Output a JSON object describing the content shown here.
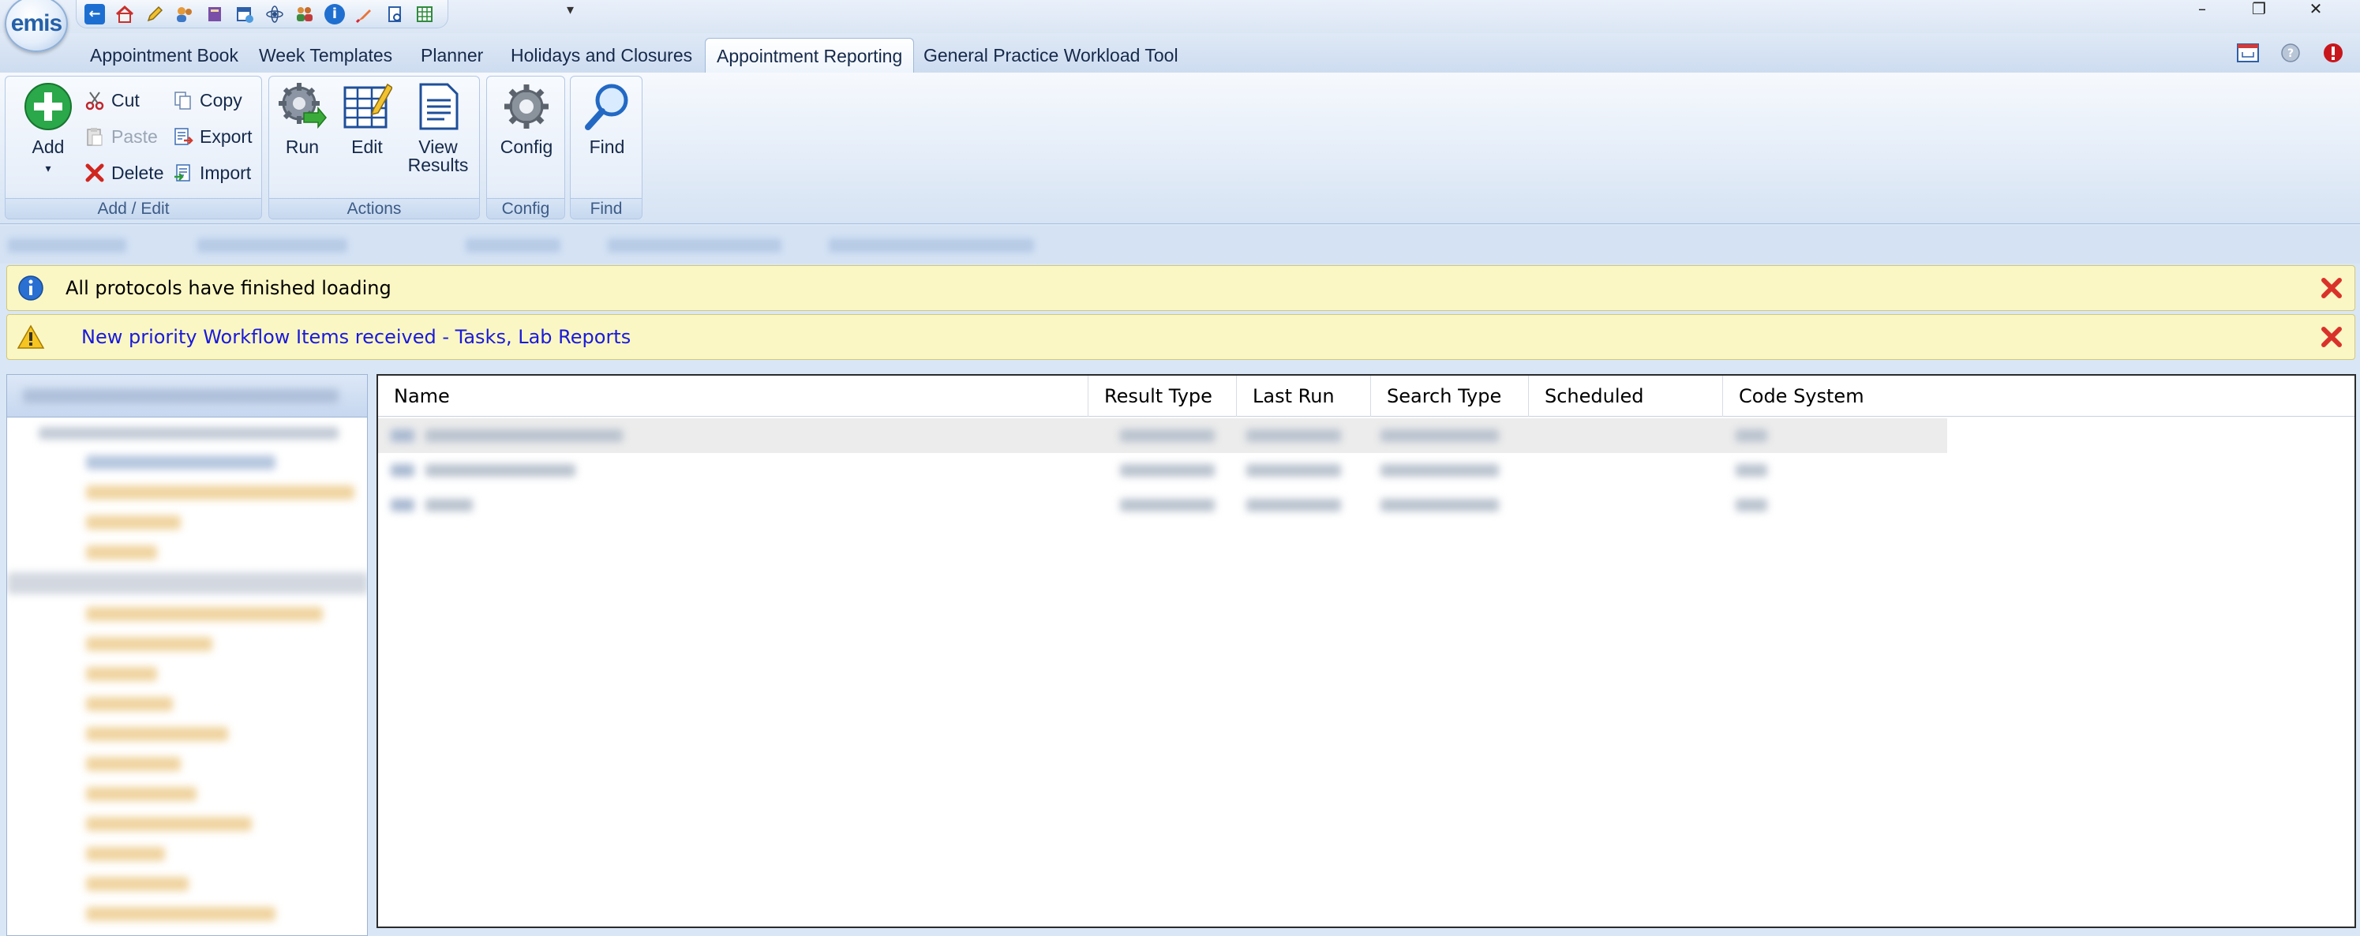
{
  "app": {
    "logo_text": "emis",
    "window_controls": [
      "–",
      "❐",
      "✕"
    ],
    "quick_access_icons": [
      "back-icon",
      "home-icon",
      "pencil-icon",
      "users-icon",
      "notebook-icon",
      "calendar-icon",
      "molecule-icon",
      "people-icon",
      "info-icon",
      "pen-icon",
      "document-icon",
      "spreadsheet-icon"
    ]
  },
  "tabs": [
    {
      "label": "Appointment Book",
      "active": false
    },
    {
      "label": "Week Templates",
      "active": false
    },
    {
      "label": "Planner",
      "active": false
    },
    {
      "label": "Holidays and Closures",
      "active": false
    },
    {
      "label": "Appointment Reporting",
      "active": true
    },
    {
      "label": "General Practice Workload Tool",
      "active": false
    }
  ],
  "ribbon": {
    "add_edit": {
      "label": "Add / Edit",
      "add": "Add",
      "cut": "Cut",
      "copy": "Copy",
      "paste": "Paste",
      "export": "Export",
      "delete": "Delete",
      "import": "Import"
    },
    "actions": {
      "label": "Actions",
      "run": "Run",
      "edit": "Edit",
      "view_results_1": "View",
      "view_results_2": "Results"
    },
    "config": {
      "label": "Config",
      "config": "Config"
    },
    "find": {
      "label": "Find",
      "find": "Find"
    }
  },
  "notifications": [
    {
      "type": "info",
      "text": "All protocols have finished loading",
      "color": "#000000"
    },
    {
      "type": "warning",
      "text": "New priority Workflow Items received - Tasks, Lab Reports",
      "color": "#1a1adb"
    }
  ],
  "grid": {
    "columns": [
      "Name",
      "Result Type",
      "Last Run",
      "Search Type",
      "Scheduled",
      "Code System"
    ]
  },
  "colors": {
    "accent": "#2561a8",
    "notify_bg": "#fbf7c4",
    "close_red": "#d9322b"
  }
}
